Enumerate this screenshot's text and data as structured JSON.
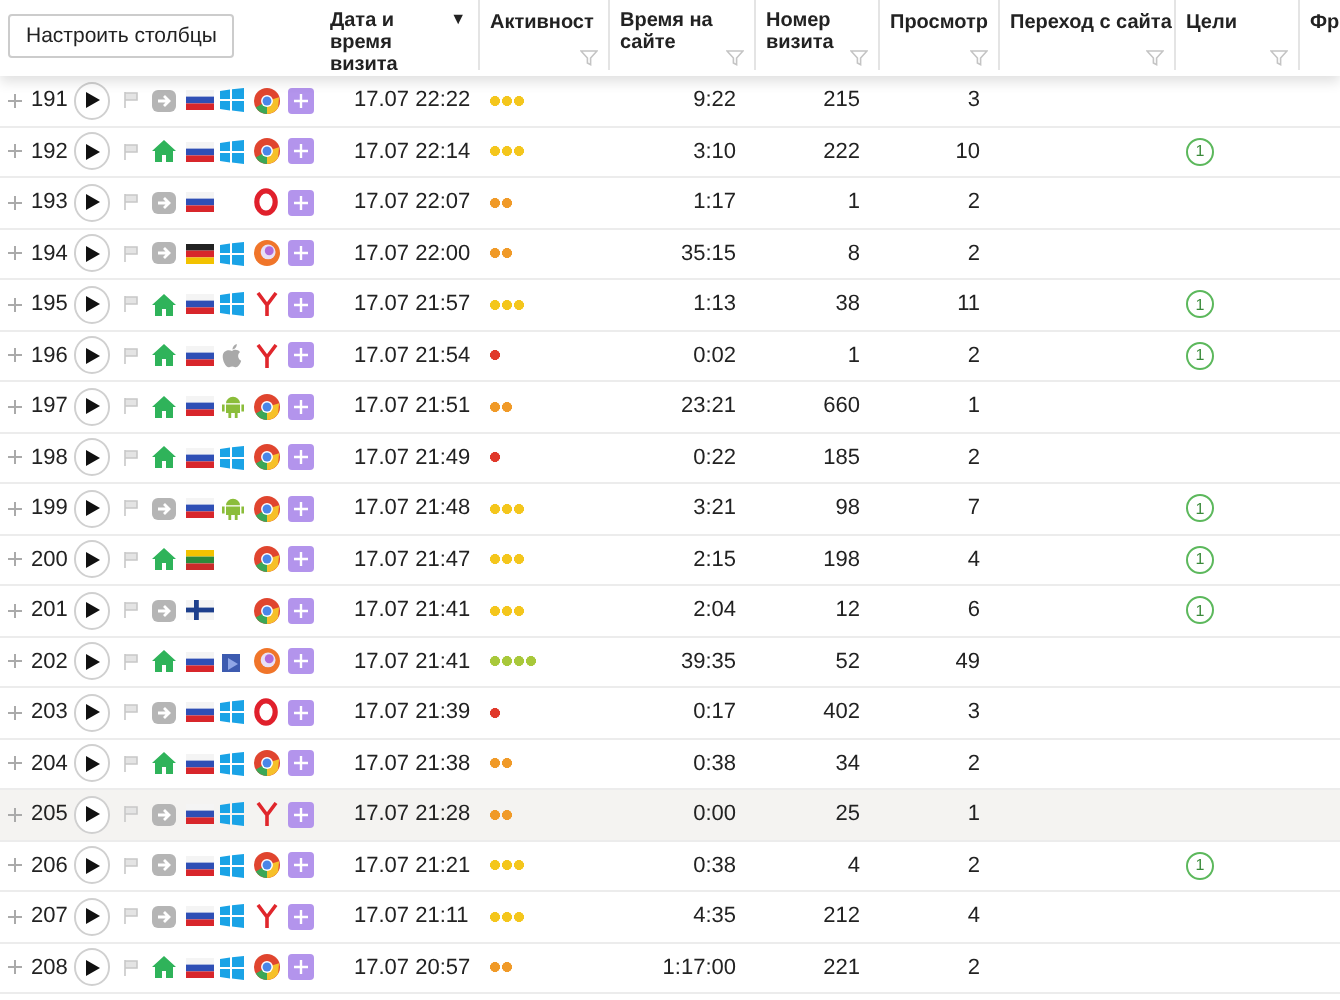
{
  "toolbar": {
    "button": "Настроить столбцы"
  },
  "columns": [
    {
      "label": "Дата и время визита",
      "sort_indicator": "▼",
      "filter": false
    },
    {
      "label": "Активност",
      "filter": true
    },
    {
      "label": "Время на сайте",
      "filter": true
    },
    {
      "label": "Номер визита",
      "filter": true
    },
    {
      "label": "Просмотр",
      "filter": true
    },
    {
      "label": "Переход с сайта",
      "filter": true
    },
    {
      "label": "Цели",
      "filter": true
    },
    {
      "label": "Фр",
      "filter": false
    }
  ],
  "rows": [
    {
      "number": "191",
      "source": {
        "kind": "direct"
      },
      "country": {
        "kind": "ru"
      },
      "os": {
        "kind": "windows"
      },
      "browser": {
        "kind": "chrome"
      },
      "date": "17.07 22:22",
      "level": 0.75,
      "time": "9:22",
      "visit": "215",
      "views": "3",
      "selected": false
    },
    {
      "number": "192",
      "source": {
        "kind": "home"
      },
      "country": {
        "kind": "ru"
      },
      "os": {
        "kind": "windows"
      },
      "browser": {
        "kind": "chrome"
      },
      "date": "17.07 22:14",
      "level": 0.75,
      "time": "3:10",
      "visit": "222",
      "views": "10",
      "goals": "1",
      "selected": false
    },
    {
      "number": "193",
      "source": {
        "kind": "direct"
      },
      "country": {
        "kind": "ru"
      },
      "browser": {
        "kind": "opera"
      },
      "date": "17.07 22:07",
      "level": 0.5,
      "time": "1:17",
      "visit": "1",
      "views": "2",
      "selected": false
    },
    {
      "number": "194",
      "source": {
        "kind": "direct"
      },
      "country": {
        "kind": "de"
      },
      "os": {
        "kind": "windows"
      },
      "browser": {
        "kind": "firefox"
      },
      "date": "17.07 22:00",
      "level": 0.5,
      "time": "35:15",
      "visit": "8",
      "views": "2",
      "selected": false
    },
    {
      "number": "195",
      "source": {
        "kind": "home"
      },
      "country": {
        "kind": "ru"
      },
      "os": {
        "kind": "windows"
      },
      "browser": {
        "kind": "yandex"
      },
      "date": "17.07 21:57",
      "level": 0.75,
      "time": "1:13",
      "visit": "38",
      "views": "11",
      "goals": "1",
      "selected": false
    },
    {
      "number": "196",
      "source": {
        "kind": "home"
      },
      "country": {
        "kind": "ru"
      },
      "os": {
        "kind": "apple"
      },
      "browser": {
        "kind": "yandex"
      },
      "date": "17.07 21:54",
      "level": 0.25,
      "time": "0:02",
      "visit": "1",
      "views": "2",
      "goals": "1",
      "selected": false
    },
    {
      "number": "197",
      "source": {
        "kind": "home"
      },
      "country": {
        "kind": "ru"
      },
      "os": {
        "kind": "android"
      },
      "browser": {
        "kind": "chrome"
      },
      "date": "17.07 21:51",
      "level": 0.5,
      "time": "23:21",
      "visit": "660",
      "views": "1",
      "selected": false
    },
    {
      "number": "198",
      "source": {
        "kind": "home"
      },
      "country": {
        "kind": "ru"
      },
      "os": {
        "kind": "windows"
      },
      "browser": {
        "kind": "chrome"
      },
      "date": "17.07 21:49",
      "level": 0.25,
      "time": "0:22",
      "visit": "185",
      "views": "2",
      "selected": false
    },
    {
      "number": "199",
      "source": {
        "kind": "direct"
      },
      "country": {
        "kind": "ru"
      },
      "os": {
        "kind": "android"
      },
      "browser": {
        "kind": "chrome"
      },
      "date": "17.07 21:48",
      "level": 0.75,
      "time": "3:21",
      "visit": "98",
      "views": "7",
      "goals": "1",
      "selected": false
    },
    {
      "number": "200",
      "source": {
        "kind": "home"
      },
      "country": {
        "kind": "lt"
      },
      "browser": {
        "kind": "chrome"
      },
      "date": "17.07 21:47",
      "level": 0.75,
      "time": "2:15",
      "visit": "198",
      "views": "4",
      "goals": "1",
      "selected": false
    },
    {
      "number": "201",
      "source": {
        "kind": "direct"
      },
      "country": {
        "kind": "fi"
      },
      "browser": {
        "kind": "chrome"
      },
      "date": "17.07 21:41",
      "level": 0.75,
      "time": "2:04",
      "visit": "12",
      "views": "6",
      "goals": "1",
      "selected": false
    },
    {
      "number": "202",
      "source": {
        "kind": "home"
      },
      "country": {
        "kind": "ru"
      },
      "os": {
        "kind": "other"
      },
      "browser": {
        "kind": "firefox"
      },
      "date": "17.07 21:41",
      "level": 1,
      "time": "39:35",
      "visit": "52",
      "views": "49",
      "selected": false
    },
    {
      "number": "203",
      "source": {
        "kind": "direct"
      },
      "country": {
        "kind": "ru"
      },
      "os": {
        "kind": "windows"
      },
      "browser": {
        "kind": "opera"
      },
      "date": "17.07 21:39",
      "level": 0.25,
      "time": "0:17",
      "visit": "402",
      "views": "3",
      "selected": false
    },
    {
      "number": "204",
      "source": {
        "kind": "home"
      },
      "country": {
        "kind": "ru"
      },
      "os": {
        "kind": "windows"
      },
      "browser": {
        "kind": "chrome"
      },
      "date": "17.07 21:38",
      "level": 0.5,
      "time": "0:38",
      "visit": "34",
      "views": "2",
      "selected": false
    },
    {
      "number": "205",
      "source": {
        "kind": "direct"
      },
      "country": {
        "kind": "ru"
      },
      "os": {
        "kind": "windows"
      },
      "browser": {
        "kind": "yandex"
      },
      "date": "17.07 21:28",
      "level": 0.5,
      "time": "0:00",
      "visit": "25",
      "views": "1",
      "selected": true
    },
    {
      "number": "206",
      "source": {
        "kind": "direct"
      },
      "country": {
        "kind": "ru"
      },
      "os": {
        "kind": "windows"
      },
      "browser": {
        "kind": "chrome"
      },
      "date": "17.07 21:21",
      "level": 0.75,
      "time": "0:38",
      "visit": "4",
      "views": "2",
      "goals": "1",
      "selected": false
    },
    {
      "number": "207",
      "source": {
        "kind": "direct"
      },
      "country": {
        "kind": "ru"
      },
      "os": {
        "kind": "windows"
      },
      "browser": {
        "kind": "yandex"
      },
      "date": "17.07 21:11",
      "level": 0.75,
      "time": "4:35",
      "visit": "212",
      "views": "4",
      "selected": false
    },
    {
      "number": "208",
      "source": {
        "kind": "home"
      },
      "country": {
        "kind": "ru"
      },
      "os": {
        "kind": "windows"
      },
      "browser": {
        "kind": "chrome"
      },
      "date": "17.07 20:57",
      "level": 0.5,
      "time": "1:17:00",
      "visit": "221",
      "views": "2",
      "selected": false
    }
  ]
}
